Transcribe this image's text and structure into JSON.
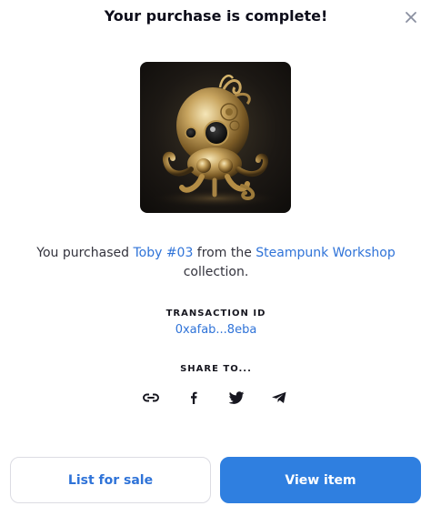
{
  "modal": {
    "title": "Your purchase is complete!",
    "close_icon": "close-icon"
  },
  "nft": {
    "image_icon": "steampunk-octopus-image"
  },
  "purchase": {
    "prefix": "You purchased ",
    "item_name": "Toby #03",
    "middle": " from the ",
    "collection_name": "Steampunk Workshop",
    "suffix": " collection."
  },
  "transaction": {
    "label": "TRANSACTION ID",
    "id": "0xafab...8eba"
  },
  "share": {
    "label": "SHARE TO...",
    "icons": [
      "link-icon",
      "facebook-icon",
      "twitter-icon",
      "telegram-icon"
    ]
  },
  "actions": {
    "list_for_sale_label": "List for sale",
    "view_item_label": "View item"
  },
  "colors": {
    "accent": "#2f73d8",
    "primary_button": "#2f7fe0",
    "title_text": "#0d0d1a"
  }
}
